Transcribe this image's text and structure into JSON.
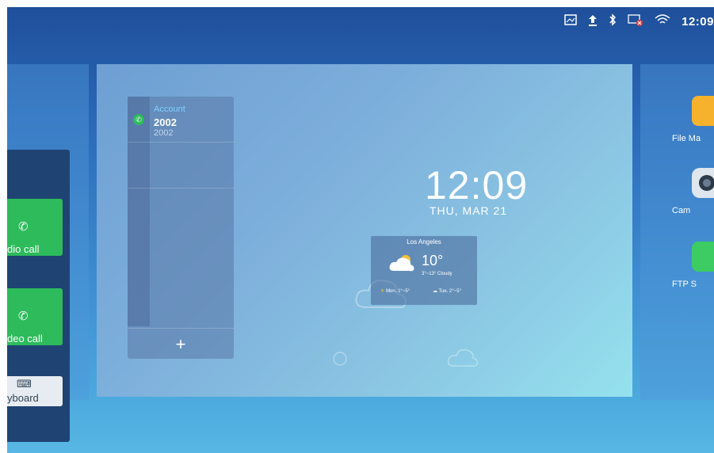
{
  "status_bar": {
    "time": "12:09",
    "icons": [
      "screenshot-icon",
      "upload-icon",
      "bluetooth-icon",
      "network-error-icon",
      "wifi-icon"
    ]
  },
  "left_panel": {
    "audio_call_label": "dio call",
    "video_call_label": "deo call",
    "keyboard_label": "yboard"
  },
  "account_widget": {
    "label": "Account",
    "number": "2002",
    "sub_number": "2002",
    "add_symbol": "+"
  },
  "clock_widget": {
    "time": "12:09",
    "date": "THU, MAR 21"
  },
  "weather_widget": {
    "city": "Los Angeles",
    "temperature": "10°",
    "range_desc": "3°~13°  Cloudy",
    "forecast": [
      {
        "day": "Mon.",
        "range": "1°~5°"
      },
      {
        "day": "Tue.",
        "range": "2°~5°"
      }
    ]
  },
  "right_panel": {
    "apps": [
      {
        "label": "File Ma",
        "icon": "folder-icon",
        "color": "#f6b22c"
      },
      {
        "label": "Cam",
        "icon": "camera-icon",
        "color": "#dfe6ee"
      },
      {
        "label": "FTP S",
        "icon": "ftp-icon",
        "color": "#3ccc63"
      }
    ]
  }
}
